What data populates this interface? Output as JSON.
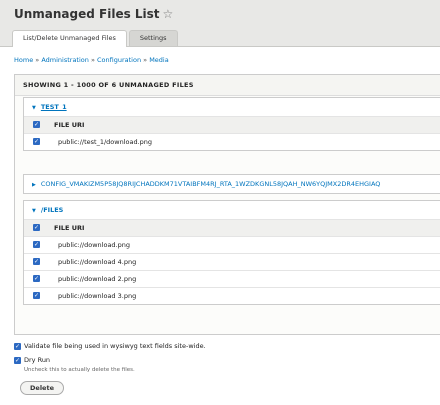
{
  "page": {
    "title": "Unmanaged Files List",
    "tabs": [
      {
        "label": "List/Delete Unmanaged Files"
      },
      {
        "label": "Settings"
      }
    ],
    "breadcrumb": [
      "Home",
      "Administration",
      "Configuration",
      "Media"
    ],
    "summary": "SHOWING 1 - 1000 OF 6 UNMANAGED FILES"
  },
  "groups": [
    {
      "label": "TEST_1",
      "expanded": true,
      "column_header": "FILE URI",
      "files": [
        "public://test_1/download.png"
      ]
    },
    {
      "label": "CONFIG_VMAKIZM5P58JQ8RIJCHADDKM71VTAIBFM4RJ_RTA_1WZDKGNL58JQAH_NW6YQJMX2DR4EHGIAQ",
      "expanded": false
    },
    {
      "label": "/FILES",
      "expanded": true,
      "column_header": "FILE URI",
      "files": [
        "public://download.png",
        "public://download 4.png",
        "public://download 2.png",
        "public://download 3.png"
      ]
    }
  ],
  "options": {
    "validate_label": "Validate file being used in wysiwyg text fields site-wide.",
    "dry_run_label": "Dry Run",
    "dry_run_desc": "Uncheck this to actually delete the files.",
    "delete_label": "Delete"
  },
  "colors": {
    "link": "#0074bd",
    "checkbox": "#2c69c2"
  }
}
